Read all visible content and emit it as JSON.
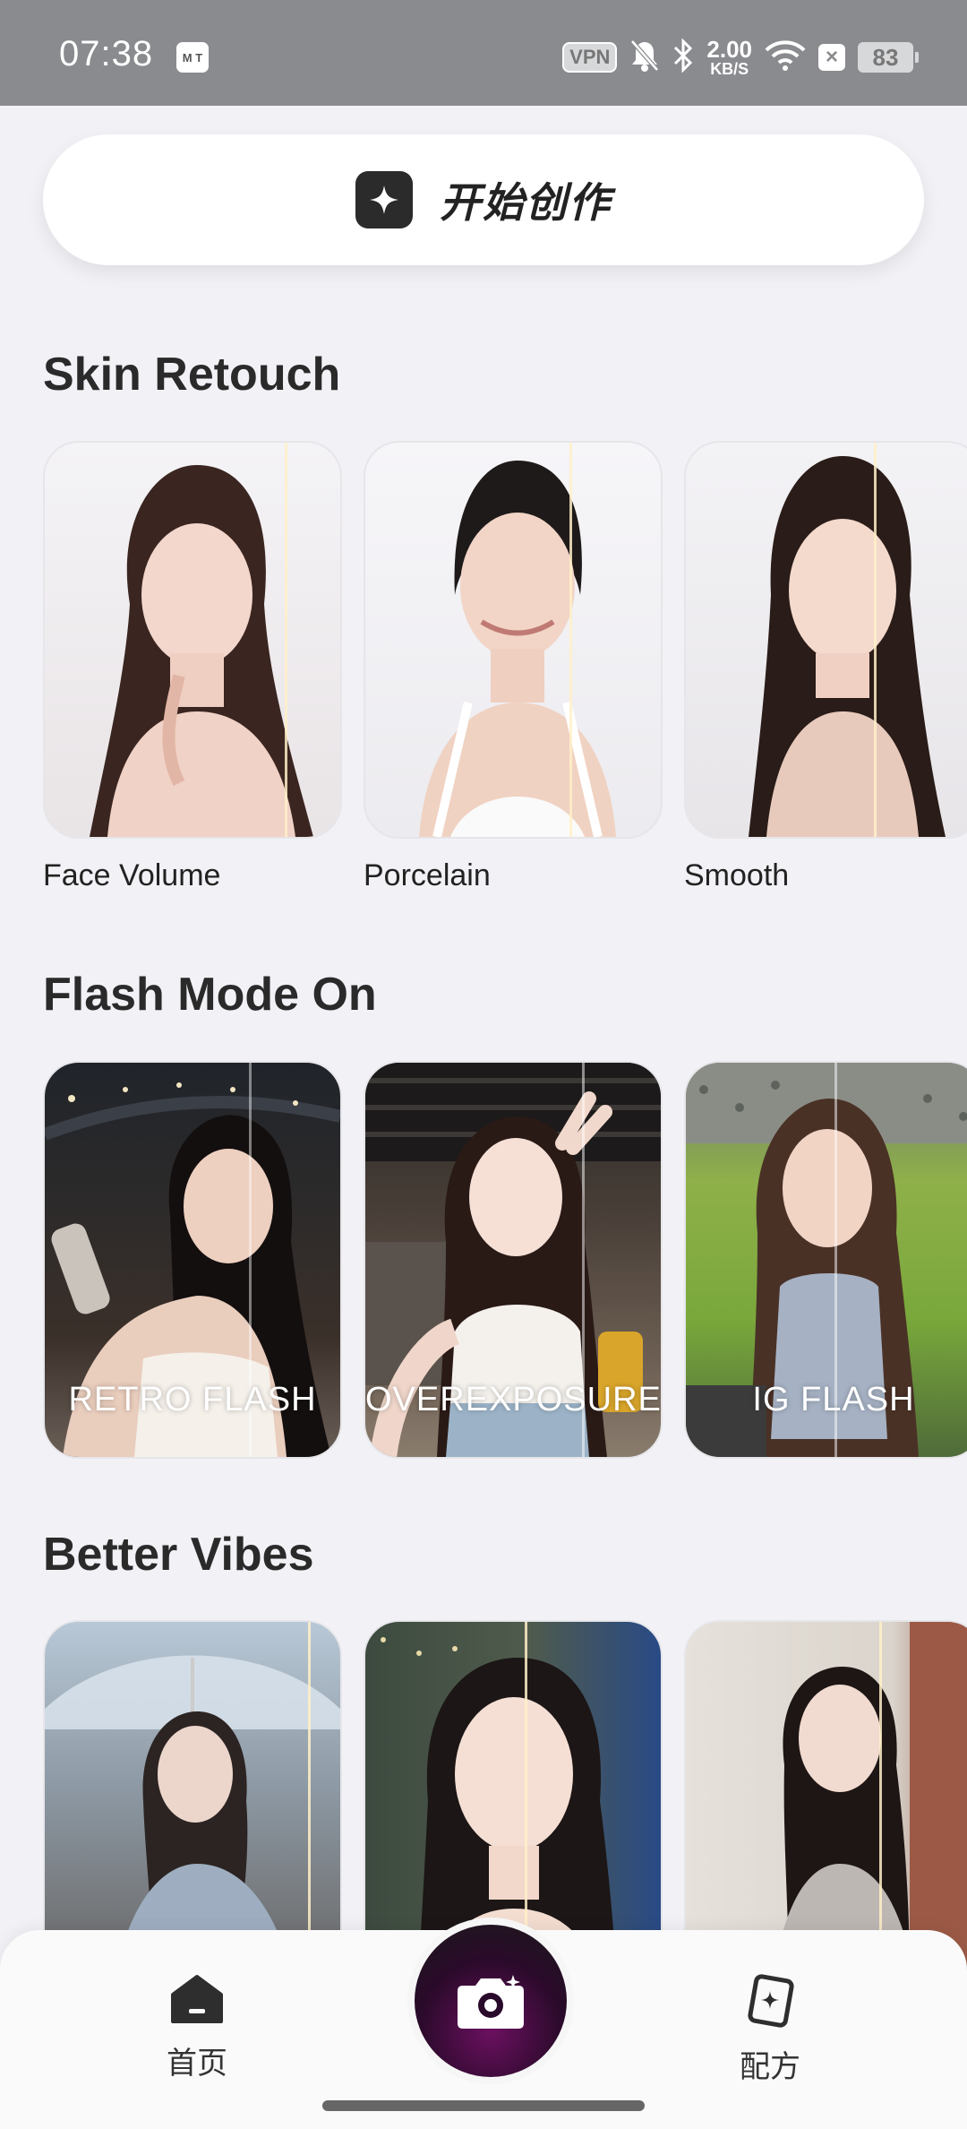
{
  "status": {
    "time": "07:38",
    "app_icon": "M T",
    "vpn": "VPN",
    "speed_value": "2.00",
    "speed_unit": "KB/S",
    "battery": "83",
    "icons": [
      "silent-bell-icon",
      "bluetooth-icon",
      "wifi-icon",
      "close-badge-icon"
    ]
  },
  "create": {
    "label": "开始创作",
    "icon": "sparkle-icon"
  },
  "sections": [
    {
      "title": "Skin Retouch",
      "cards": [
        {
          "caption": "Face Volume"
        },
        {
          "caption": "Porcelain"
        },
        {
          "caption": "Smooth"
        }
      ]
    },
    {
      "title": "Flash Mode On",
      "cards": [
        {
          "overlay": "RETRO FLASH"
        },
        {
          "overlay": "OVEREXPOSURE"
        },
        {
          "overlay": "IG FLASH"
        }
      ]
    },
    {
      "title": "Better Vibes",
      "cards": [
        {},
        {},
        {}
      ]
    }
  ],
  "nav": {
    "home_label": "首页",
    "recipe_label": "配方",
    "icons": [
      "home-icon",
      "camera-icon",
      "recipe-card-icon"
    ]
  },
  "colors": {
    "background": "#f2f1f6",
    "status_bar": "#8a8b8f",
    "camera_button": "#6b1060"
  }
}
